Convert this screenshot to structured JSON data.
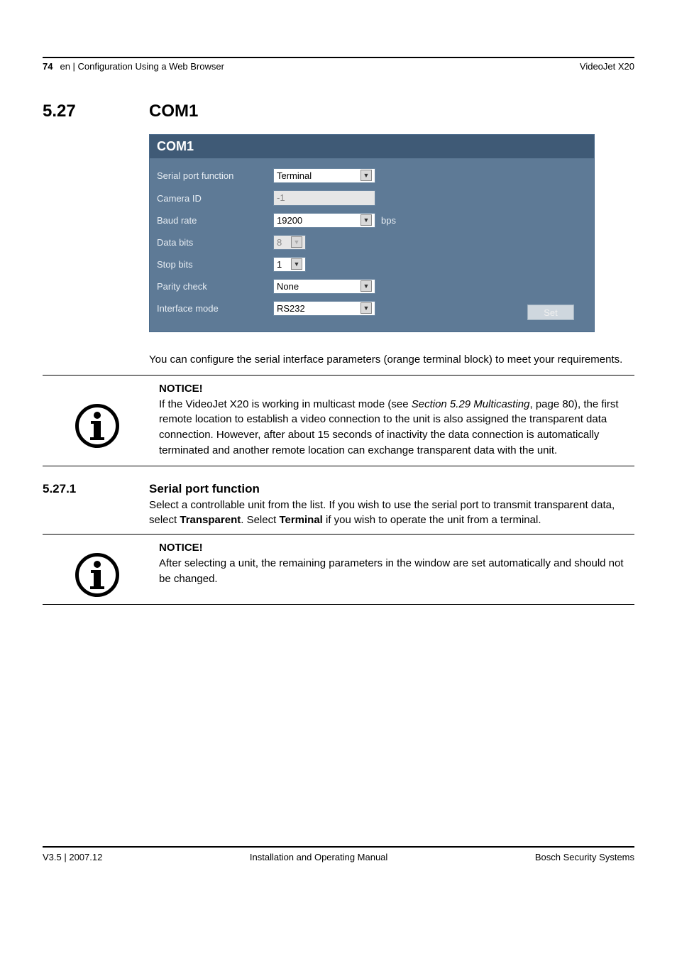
{
  "header": {
    "page_number": "74",
    "breadcrumb": "en | Configuration Using a Web Browser",
    "product": "VideoJet X20"
  },
  "section": {
    "number": "5.27",
    "title": "COM1"
  },
  "panel": {
    "title": "COM1",
    "rows": {
      "serial_port_function": {
        "label": "Serial port function",
        "value": "Terminal"
      },
      "camera_id": {
        "label": "Camera ID",
        "value": "-1"
      },
      "baud_rate": {
        "label": "Baud rate",
        "value": "19200",
        "unit": "bps"
      },
      "data_bits": {
        "label": "Data bits",
        "value": "8"
      },
      "stop_bits": {
        "label": "Stop bits",
        "value": "1"
      },
      "parity_check": {
        "label": "Parity check",
        "value": "None"
      },
      "interface_mode": {
        "label": "Interface mode",
        "value": "RS232"
      }
    },
    "set_button": "Set"
  },
  "intro_para": "You can configure the serial interface parameters (orange terminal block) to meet your requirements.",
  "notice1": {
    "title": "NOTICE!",
    "pre": "If the VideoJet X20 is working in multicast mode (see ",
    "ref": "Section 5.29 Multicasting",
    "post": ", page 80), the first remote location to establish a video connection to the unit is also assigned the transparent data connection. However, after about 15 seconds of inactivity the data connection is automatically terminated and another remote location can exchange transparent data with the unit."
  },
  "subsection": {
    "number": "5.27.1",
    "title": "Serial port function",
    "para_pre": "Select a controllable unit from the list. If you wish to use the serial port to transmit transparent data, select ",
    "b1": "Transparent",
    "mid": ". Select ",
    "b2": "Terminal",
    "para_post": " if you wish to operate the unit from a terminal."
  },
  "notice2": {
    "title": "NOTICE!",
    "text": "After selecting a unit, the remaining parameters in the window are set automatically and should not be changed."
  },
  "footer": {
    "left": "V3.5 | 2007.12",
    "center": "Installation and Operating Manual",
    "right": "Bosch Security Systems"
  }
}
